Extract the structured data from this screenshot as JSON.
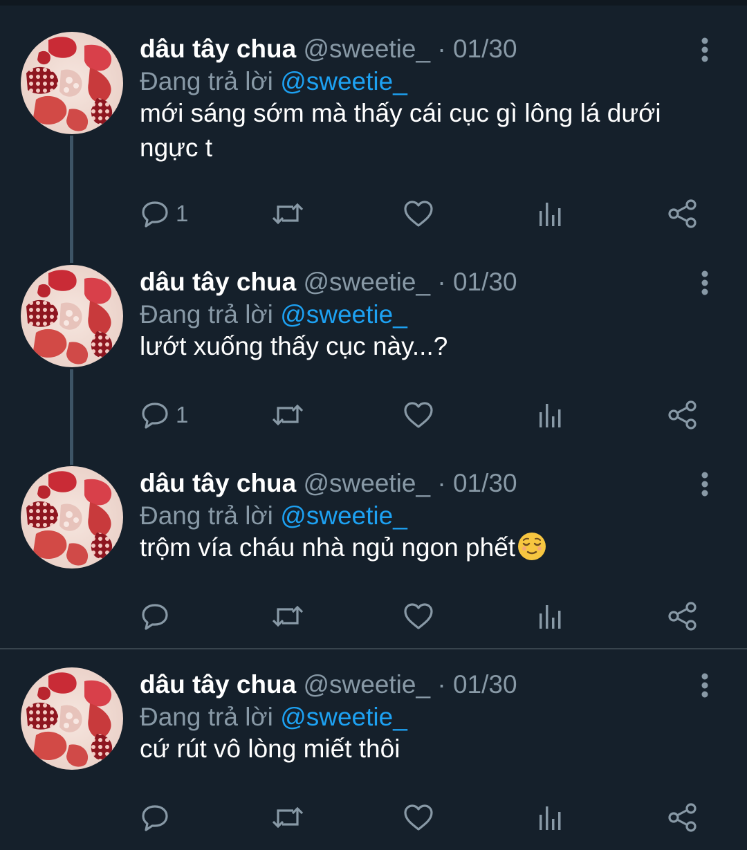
{
  "colors": {
    "background": "#15202b",
    "primary_text": "#ffffff",
    "secondary_text": "#8899a6",
    "link": "#1da1f2",
    "thread_line": "#3d5466"
  },
  "tweets": [
    {
      "name": "dâu tây chua",
      "handle": "@sweetie_",
      "separator": "·",
      "date": "01/30",
      "replying_label": "Đang trả lời",
      "replying_to": "@sweetie_",
      "text": "mới sáng sớm mà thấy cái cục gì lông lá dưới ngực t",
      "reply_count": "1",
      "icons": [
        "reply-icon",
        "retweet-icon",
        "like-icon",
        "analytics-icon",
        "share-icon"
      ]
    },
    {
      "name": "dâu tây chua",
      "handle": "@sweetie_",
      "separator": "·",
      "date": "01/30",
      "replying_label": "Đang trả lời",
      "replying_to": "@sweetie_",
      "text": "lướt xuống thấy cục này...?",
      "reply_count": "1",
      "icons": [
        "reply-icon",
        "retweet-icon",
        "like-icon",
        "analytics-icon",
        "share-icon"
      ]
    },
    {
      "name": "dâu tây chua",
      "handle": "@sweetie_",
      "separator": "·",
      "date": "01/30",
      "replying_label": "Đang trả lời",
      "replying_to": "@sweetie_",
      "text": "trộm vía cháu nhà ngủ ngon phết",
      "emoji": "relieved-face-emoji",
      "reply_count": "",
      "icons": [
        "reply-icon",
        "retweet-icon",
        "like-icon",
        "analytics-icon",
        "share-icon"
      ]
    },
    {
      "name": "dâu tây chua",
      "handle": "@sweetie_",
      "separator": "·",
      "date": "01/30",
      "replying_label": "Đang trả lời",
      "replying_to": "@sweetie_",
      "text": "cứ rút vô lòng miết thôi",
      "reply_count": "",
      "icons": [
        "reply-icon",
        "retweet-icon",
        "like-icon",
        "analytics-icon",
        "share-icon"
      ]
    }
  ]
}
